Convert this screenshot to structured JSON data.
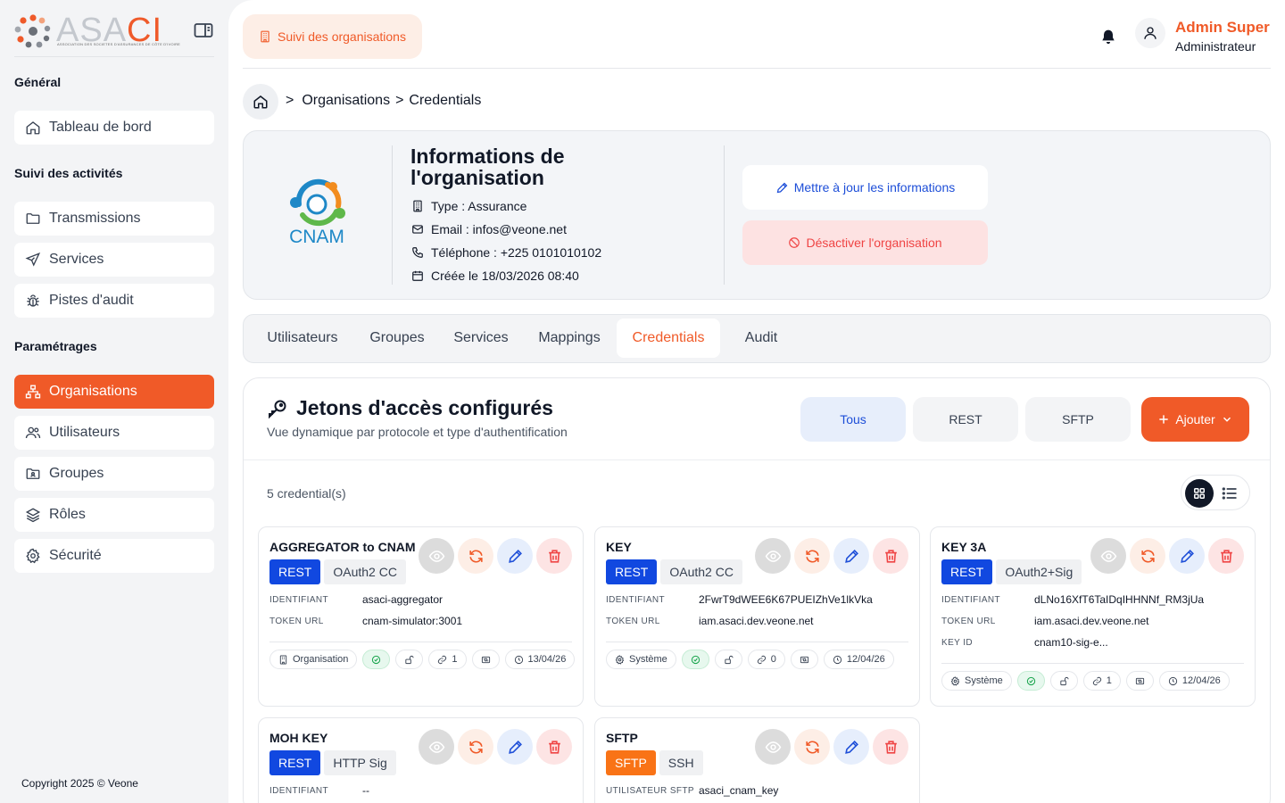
{
  "brand": {
    "name_part1": "ASA",
    "name_part2": "CI",
    "subtitle": "ASSOCIATION DES SOCIETES D'ASSURANCES DE CÔTE D'IVOIRE",
    "accent": "#f05a28"
  },
  "sidebar": {
    "sections": [
      {
        "title": "Général",
        "items": [
          {
            "label": "Tableau de bord",
            "icon": "home-icon"
          }
        ]
      },
      {
        "title": "Suivi des activités",
        "items": [
          {
            "label": "Transmissions",
            "icon": "folder-icon"
          },
          {
            "label": "Services",
            "icon": "send-icon"
          },
          {
            "label": "Pistes d'audit",
            "icon": "bug-icon"
          }
        ]
      },
      {
        "title": "Paramétrages",
        "items": [
          {
            "label": "Organisations",
            "icon": "network-icon",
            "active": true
          },
          {
            "label": "Utilisateurs",
            "icon": "users-icon"
          },
          {
            "label": "Groupes",
            "icon": "folder-group-icon"
          },
          {
            "label": "Rôles",
            "icon": "layers-icon"
          },
          {
            "label": "Sécurité",
            "icon": "gear-icon"
          }
        ]
      }
    ],
    "copyright": "Copyright 2025 © Veone"
  },
  "topbar": {
    "tab_label": "Suivi des organisations",
    "user_name": "Admin Super",
    "user_role": "Administrateur"
  },
  "breadcrumb": {
    "sep1": ">",
    "item1": "Organisations",
    "sep2": ">",
    "item2": "Credentials"
  },
  "organization": {
    "logo_text": "CNAM",
    "title": "Informations de l'organisation",
    "type": "Type : Assurance",
    "email": "Email : infos@veone.net",
    "phone": "Téléphone : +225 0101010102",
    "created": "Créée le 18/03/2026 08:40",
    "update_label": "Mettre à jour les informations",
    "deactivate_label": "Désactiver l'organisation"
  },
  "tabs": [
    "Utilisateurs",
    "Groupes",
    "Services",
    "Mappings",
    "Credentials",
    "Audit"
  ],
  "active_tab": "Credentials",
  "credentials": {
    "title": "Jetons d'accès configurés",
    "subtitle": "Vue dynamique par protocole et type d'authentification",
    "filters": [
      "Tous",
      "REST",
      "SFTP"
    ],
    "active_filter": "Tous",
    "add_label": "Ajouter",
    "count": "5 credential(s)",
    "cards": [
      {
        "name": "AGGREGATOR to CNAM",
        "protocol": "REST",
        "auth": "OAuth2 CC",
        "fields": [
          {
            "k": "IDENTIFIANT",
            "v": "asaci-aggregator"
          },
          {
            "k": "TOKEN URL",
            "v": "cnam-simulator:3001"
          }
        ],
        "owner": "Organisation",
        "links": "1",
        "date": "13/04/26"
      },
      {
        "name": "KEY",
        "protocol": "REST",
        "auth": "OAuth2 CC",
        "fields": [
          {
            "k": "IDENTIFIANT",
            "v": "2FwrT9dWEE6K67PUEIZhVe1lkVka"
          },
          {
            "k": "TOKEN URL",
            "v": "iam.asaci.dev.veone.net"
          }
        ],
        "owner": "Système",
        "links": "0",
        "date": "12/04/26"
      },
      {
        "name": "KEY 3A",
        "protocol": "REST",
        "auth": "OAuth2+Sig",
        "fields": [
          {
            "k": "IDENTIFIANT",
            "v": "dLNo16XfT6TaIDqIHHNNf_RM3jUa"
          },
          {
            "k": "TOKEN URL",
            "v": "iam.asaci.dev.veone.net"
          },
          {
            "k": "KEY ID",
            "v": "cnam10-sig-e..."
          }
        ],
        "owner": "Système",
        "links": "1",
        "date": "12/04/26"
      },
      {
        "name": "MOH KEY",
        "protocol": "REST",
        "auth": "HTTP Sig",
        "fields": [
          {
            "k": "IDENTIFIANT",
            "v": "--"
          }
        ]
      },
      {
        "name": "SFTP",
        "protocol": "SFTP",
        "auth": "SSH",
        "fields": [
          {
            "k": "UTILISATEUR SFTP",
            "v": "asaci_cnam_key"
          }
        ]
      }
    ]
  }
}
